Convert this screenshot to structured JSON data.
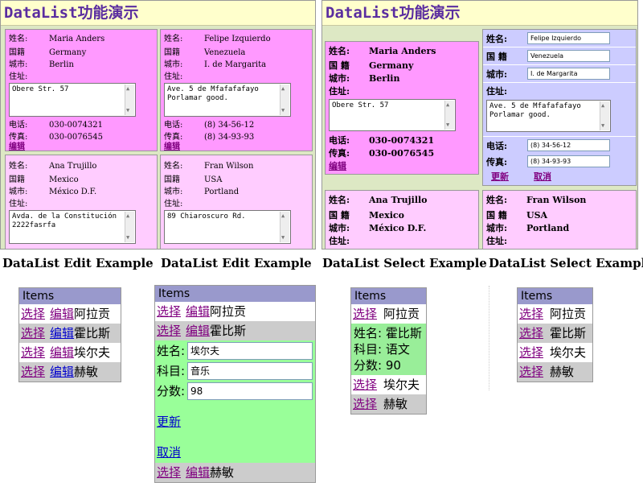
{
  "banner_title": "DataList功能演示",
  "labels": {
    "name": "姓名:",
    "country_colon": "国籍",
    "country_space": "国 籍",
    "city": "城市:",
    "address": "住址:",
    "phone": "电话:",
    "fax": "传真:",
    "edit": "编辑",
    "update": "更新",
    "cancel": "取消"
  },
  "customers": [
    {
      "name": "Maria Anders",
      "country": "Germany",
      "city": "Berlin",
      "address": "Obere Str. 57",
      "phone": "030-0074321",
      "fax": "030-0076545"
    },
    {
      "name": "Felipe Izquierdo",
      "country": "Venezuela",
      "city": "I. de Margarita",
      "address": "Ave. 5 de Mfafafafayo\nPorlamar good.",
      "phone": "(8) 34-56-12",
      "fax": "(8) 34-93-93"
    },
    {
      "name": "Ana Trujillo",
      "country": "Mexico",
      "city": "México D.F.",
      "address": "Avda. de la Constitución\n2222fasrfa",
      "phone": "",
      "fax": ""
    },
    {
      "name": "Fran Wilson",
      "country": "USA",
      "city": "Portland",
      "address": "89 Chiaroscuro Rd.",
      "phone": "",
      "fax": ""
    }
  ],
  "captions": [
    "DataList Edit Example",
    "DataList Edit Example",
    "DataList Select Example",
    "DataList Select Example"
  ],
  "list": {
    "header": "Items",
    "select": "选择",
    "edit": "编辑",
    "people": [
      "阿拉贡",
      "霍比斯",
      "埃尔夫",
      "赫敏"
    ],
    "edit_form": {
      "name_label": "姓名:",
      "name_value": "埃尔夫",
      "subject_label": "科目:",
      "subject_value": "音乐",
      "score_label": "分数:",
      "score_value": "98",
      "update": "更新",
      "cancel": "取消"
    },
    "selected_detail": {
      "name": "姓名: 霍比斯",
      "subject": "科目: 语文",
      "score": "分数: 90"
    }
  }
}
